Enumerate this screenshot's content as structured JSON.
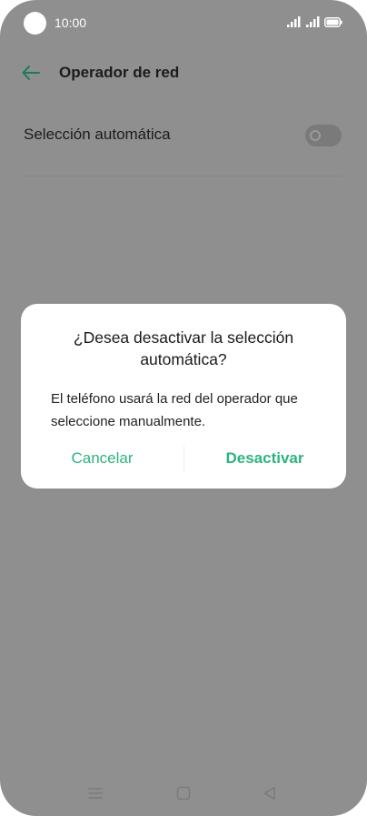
{
  "status_bar": {
    "time": "10:00",
    "icons": [
      "camera-cutout",
      "signal-strength-1",
      "signal-strength-2",
      "battery"
    ]
  },
  "app_bar": {
    "title": "Operador de red",
    "back_icon": "arrow-left-icon"
  },
  "settings": {
    "auto_select_label": "Selección automática",
    "auto_select_on": false
  },
  "dialog": {
    "title": "¿Desea desactivar la selección automática?",
    "message": "El teléfono usará la red del operador que seleccione manualmente.",
    "cancel_label": "Cancelar",
    "confirm_label": "Desactivar"
  },
  "nav_bar": {
    "icons": [
      "menu-icon",
      "home-icon",
      "back-triangle-icon"
    ]
  },
  "colors": {
    "accent": "#2db47e",
    "scrim": "#8f8f8f",
    "dialog_bg": "#ffffff",
    "text_dark": "#1c1c1c"
  }
}
